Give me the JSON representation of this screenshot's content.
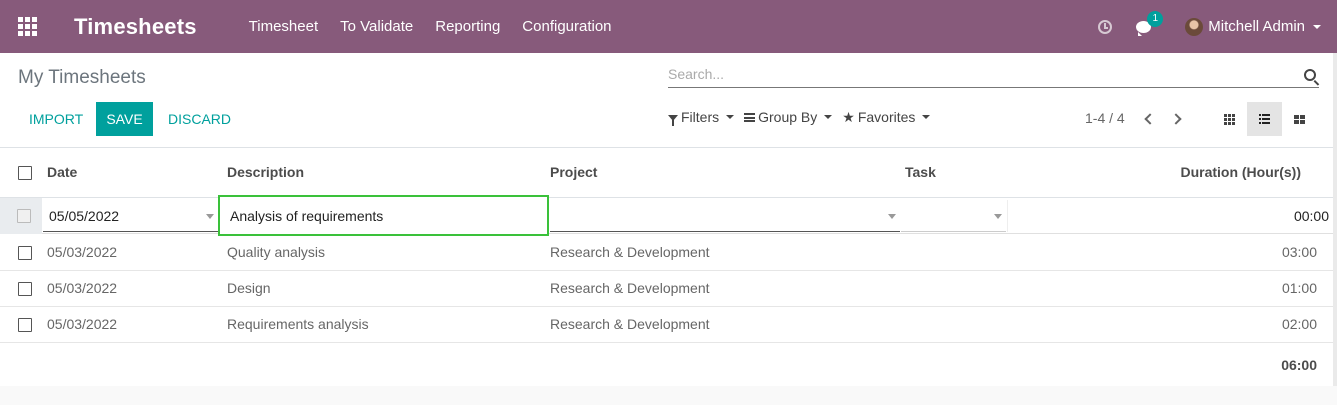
{
  "navbar": {
    "app_title": "Timesheets",
    "menu": [
      "Timesheet",
      "To Validate",
      "Reporting",
      "Configuration"
    ],
    "chat_count": "1",
    "user_name": "Mitchell Admin",
    "bg_color": "#875a7b"
  },
  "control_panel": {
    "page_title": "My Timesheets",
    "search_placeholder": "Search...",
    "import_label": "IMPORT",
    "save_label": "SAVE",
    "discard_label": "DISCARD",
    "filters_label": "Filters",
    "group_by_label": "Group By",
    "favorites_label": "Favorites",
    "pager": "1-4 / 4",
    "accent_color": "#00a09d"
  },
  "table": {
    "columns": {
      "date": "Date",
      "description": "Description",
      "project": "Project",
      "task": "Task",
      "duration": "Duration (Hour(s))"
    },
    "edit_row": {
      "date": "05/05/2022",
      "description": "Analysis of requirements",
      "project": "",
      "task": "",
      "duration": "00:00"
    },
    "rows": [
      {
        "date": "05/03/2022",
        "description": "Quality analysis",
        "project": "Research & Development",
        "task": "",
        "duration": "03:00"
      },
      {
        "date": "05/03/2022",
        "description": "Design",
        "project": "Research & Development",
        "task": "",
        "duration": "01:00"
      },
      {
        "date": "05/03/2022",
        "description": "Requirements analysis",
        "project": "Research & Development",
        "task": "",
        "duration": "02:00"
      }
    ],
    "total_duration": "06:00"
  }
}
